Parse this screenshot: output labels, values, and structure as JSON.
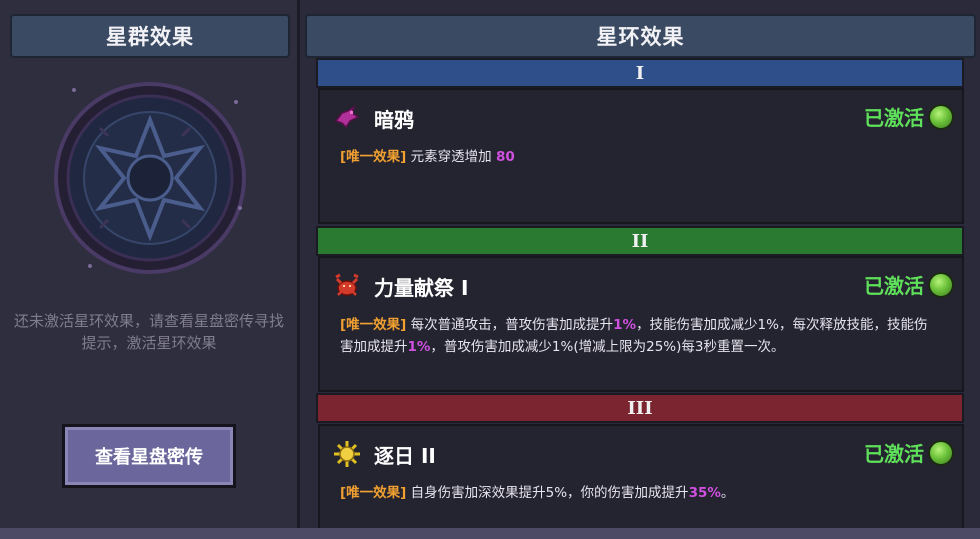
{
  "left_panel": {
    "title": "星群效果",
    "hint": "还未激活星环效果，请查看星盘密传寻找提示，激活星环效果",
    "button_label": "查看星盘密传"
  },
  "right_panel": {
    "title": "星环效果",
    "rings": [
      {
        "numeral": "I",
        "name": "暗鸦",
        "icon": "crow-icon",
        "status": "已激活",
        "tag": "[唯一效果]",
        "desc_parts": [
          "元素穿透增加 ",
          "80"
        ]
      },
      {
        "numeral": "II",
        "name": "力量献祭 I",
        "icon": "crab-icon",
        "status": "已激活",
        "tag": "[唯一效果]",
        "desc_parts": [
          "每次普通攻击，普攻伤害加成提升",
          "1%",
          "，技能伤害加成减少1%，每次释放技能，技能伤害加成提升",
          "1%",
          "，普攻伤害加成减少1%(增减上限为25%)每3秒重置一次。"
        ]
      },
      {
        "numeral": "III",
        "name": "逐日 II",
        "icon": "sun-icon",
        "status": "已激活",
        "tag": "[唯一效果]",
        "desc_parts": [
          "自身伤害加深效果提升5%，你的伤害加成提升",
          "35%",
          "。"
        ]
      }
    ]
  },
  "colors": {
    "ring_1": "#2f4f8a",
    "ring_2": "#2a7a32",
    "ring_3": "#7a2530",
    "active_status": "#5fe05a",
    "tag": "#f0a030",
    "highlight": "#d050e0"
  }
}
